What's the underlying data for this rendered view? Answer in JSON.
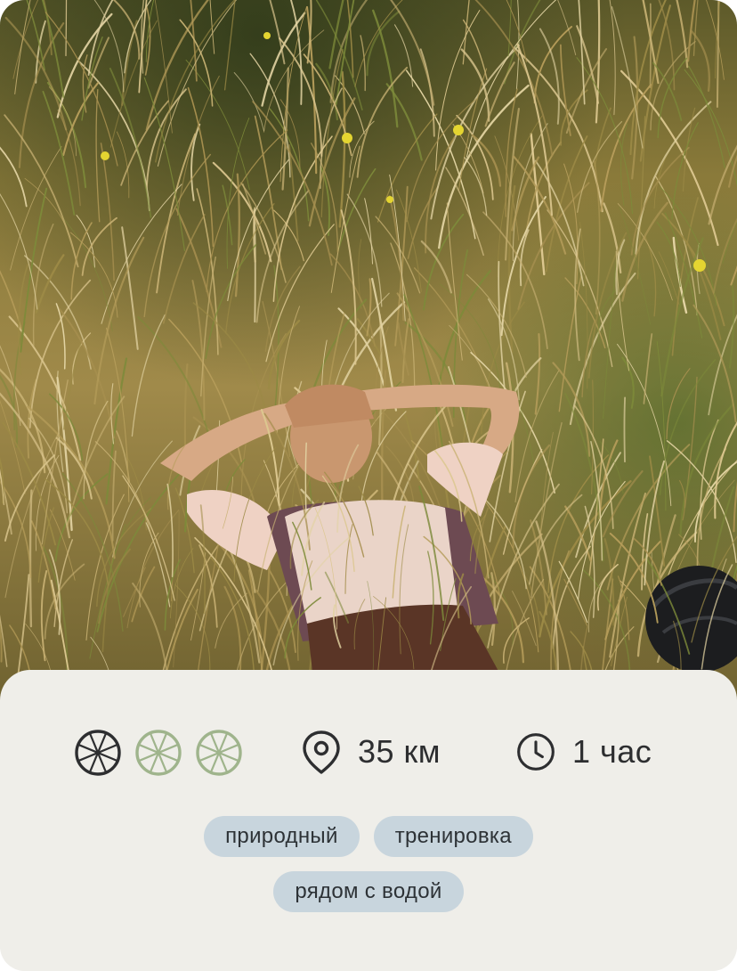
{
  "photo": {
    "alt_subject": "person-lying-in-grass"
  },
  "difficulty": {
    "level": 1,
    "max": 3,
    "icon": "wheel-icon",
    "active_color": "#2d2e30",
    "inactive_color": "#9fb48c"
  },
  "stats": {
    "distance": {
      "icon": "location-pin-icon",
      "text": "35 км"
    },
    "duration": {
      "icon": "clock-icon",
      "text": "1 час"
    }
  },
  "tags": [
    [
      "природный",
      "тренировка"
    ],
    [
      "рядом с водой"
    ]
  ],
  "colors": {
    "card_bg": "#efeee9",
    "tag_bg": "#c8d5dd",
    "text": "#2d2e30"
  }
}
